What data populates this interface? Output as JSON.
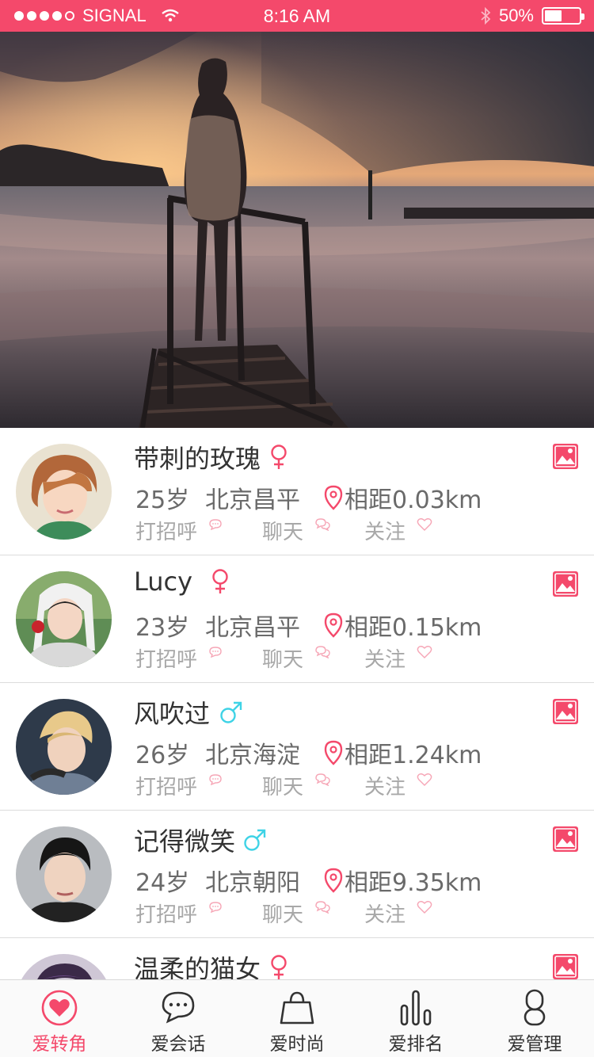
{
  "status_bar": {
    "carrier": "SIGNAL",
    "time": "8:16 AM",
    "battery": "50%",
    "battery_level": 0.5
  },
  "hero": {
    "image": "sunset-pier-photo"
  },
  "users": [
    {
      "name": "带刺的玫瑰",
      "gender": "female",
      "age": "25岁",
      "location": "北京昌平",
      "distance": "相距0.03km"
    },
    {
      "name": "Lucy",
      "gender": "female",
      "age": "23岁",
      "location": "北京昌平",
      "distance": "相距0.15km"
    },
    {
      "name": "风吹过",
      "gender": "male",
      "age": "26岁",
      "location": "北京海淀",
      "distance": "相距1.24km"
    },
    {
      "name": "记得微笑",
      "gender": "male",
      "age": "24岁",
      "location": "北京朝阳",
      "distance": "相距9.35km"
    },
    {
      "name": "温柔的猫女",
      "gender": "female",
      "age": "",
      "location": "",
      "distance": ""
    }
  ],
  "actions": {
    "greet": "打招呼",
    "chat": "聊天",
    "follow": "关注"
  },
  "tabs": [
    {
      "label": "爱转角",
      "icon": "heart-icon",
      "active": true
    },
    {
      "label": "爱会话",
      "icon": "chat-bubble-icon",
      "active": false
    },
    {
      "label": "爱时尚",
      "icon": "shopping-bag-icon",
      "active": false
    },
    {
      "label": "爱排名",
      "icon": "bar-chart-icon",
      "active": false
    },
    {
      "label": "爱管理",
      "icon": "person-icon",
      "active": false
    }
  ],
  "colors": {
    "accent": "#f4496b",
    "female": "#f4496b",
    "male": "#3fd3e6",
    "text_gray": "#6a6a6a",
    "action_gray": "#a8a8a8"
  }
}
